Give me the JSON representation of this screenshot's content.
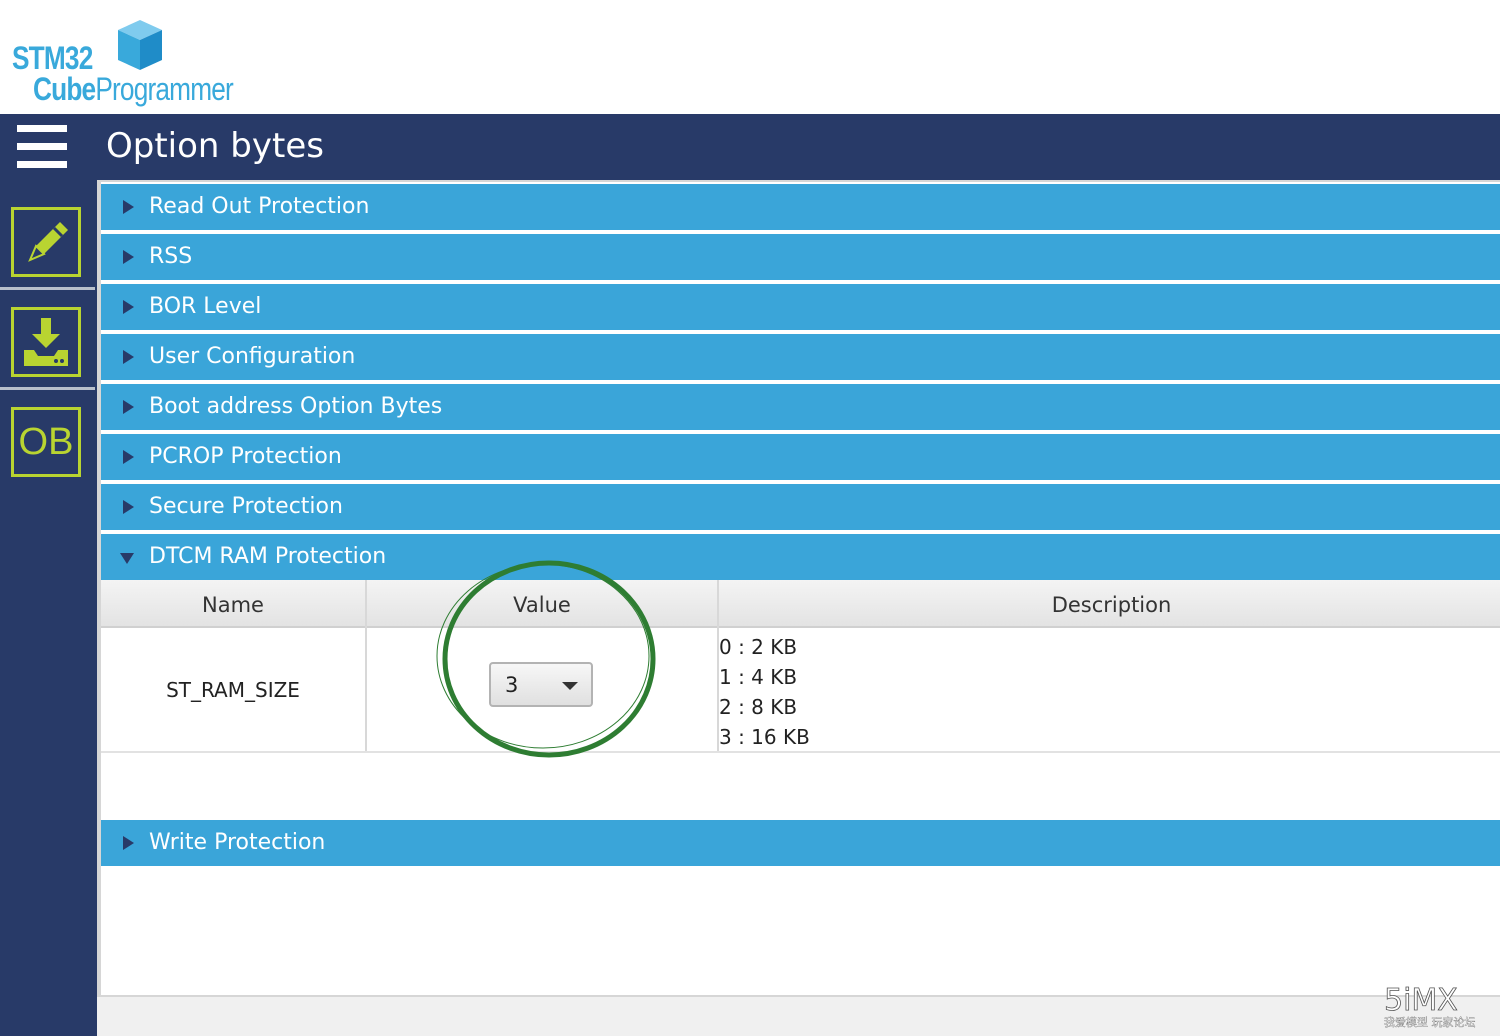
{
  "logo": {
    "line1": "STM32",
    "line2_bold": "Cube",
    "line2_light": "Programmer"
  },
  "header": {
    "title": "Option bytes"
  },
  "sidebar": {
    "items": [
      {
        "name": "erasing-programming",
        "icon": "pencil-icon"
      },
      {
        "name": "download",
        "icon": "download-icon"
      },
      {
        "name": "option-bytes",
        "icon": "ob-icon",
        "label": "OB"
      }
    ]
  },
  "sections": [
    {
      "label": "Read Out Protection",
      "expanded": false
    },
    {
      "label": "RSS",
      "expanded": false
    },
    {
      "label": "BOR Level",
      "expanded": false
    },
    {
      "label": "User Configuration",
      "expanded": false
    },
    {
      "label": "Boot address Option Bytes",
      "expanded": false
    },
    {
      "label": "PCROP Protection",
      "expanded": false
    },
    {
      "label": "Secure Protection",
      "expanded": false
    },
    {
      "label": "DTCM RAM Protection",
      "expanded": true
    },
    {
      "label": "Write Protection",
      "expanded": false
    }
  ],
  "table": {
    "headers": {
      "name": "Name",
      "value": "Value",
      "description": "Description"
    },
    "rows": [
      {
        "name": "ST_RAM_SIZE",
        "value": "3",
        "description": [
          "0 : 2 KB",
          "1 : 4 KB",
          "2 : 8 KB",
          "3 : 16 KB"
        ]
      }
    ]
  },
  "annotation": {
    "color": "#2e7d32"
  },
  "watermark": {
    "text": "5iMX",
    "subtext": "我爱模型 玩家论坛"
  },
  "colors": {
    "navy": "#283a68",
    "section_blue": "#3aa5d9",
    "accent_green": "#b9d431",
    "logo_blue": "#39a9db"
  }
}
